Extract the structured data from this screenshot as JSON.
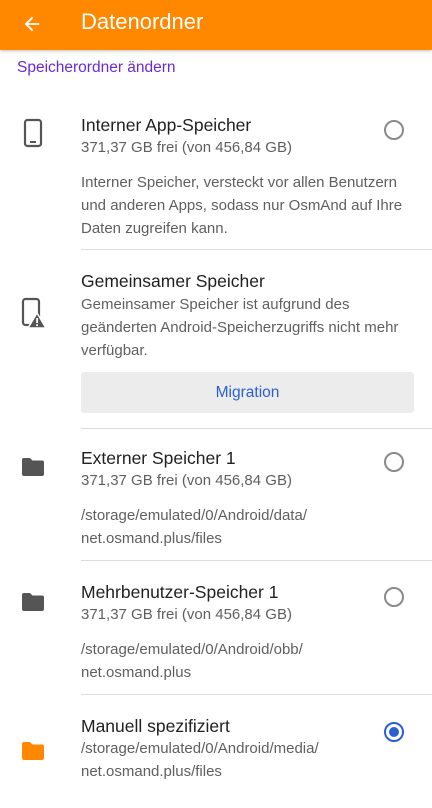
{
  "appbar": {
    "title": "Datenordner",
    "back_icon": "arrow-left-icon",
    "color": "#ff8800"
  },
  "section_header": "Speicherordner ändern",
  "items": [
    {
      "icon": "phone-icon",
      "title": "Interner App-Speicher",
      "subtitle": "371,37 GB frei (von 456,84 GB)",
      "description": "Interner Speicher, versteckt vor allen Benutzern und anderen Apps, sodass nur OsmAnd auf Ihre Daten zugreifen kann.",
      "selected": false
    },
    {
      "icon": "phone-warning-icon",
      "title": "Gemeinsamer Speicher",
      "description": "Gemeinsamer Speicher ist aufgrund des geänderten Android-Speicherzugriffs nicht mehr verfügbar.",
      "button_label": "Migration"
    },
    {
      "icon": "folder-icon",
      "title": "Externer Speicher 1",
      "subtitle": "371,37 GB frei (von 456,84 GB)",
      "path_line1": "/storage/emulated/0/Android/data/",
      "path_line2": "net.osmand.plus/files",
      "selected": false
    },
    {
      "icon": "folder-icon",
      "title": "Mehrbenutzer-Speicher 1",
      "subtitle": "371,37 GB frei (von 456,84 GB)",
      "path_line1": "/storage/emulated/0/Android/obb/",
      "path_line2": "net.osmand.plus",
      "selected": false
    },
    {
      "icon": "folder-icon",
      "title": "Manuell spezifiziert",
      "path_line1": "/storage/emulated/0/Android/media/",
      "path_line2": "net.osmand.plus/files",
      "selected": true
    }
  ],
  "colors": {
    "accent": "#2a5fd2",
    "header_purple": "#6a2ad6",
    "folder_active": "#ff8800",
    "icon_gray": "#555555"
  }
}
